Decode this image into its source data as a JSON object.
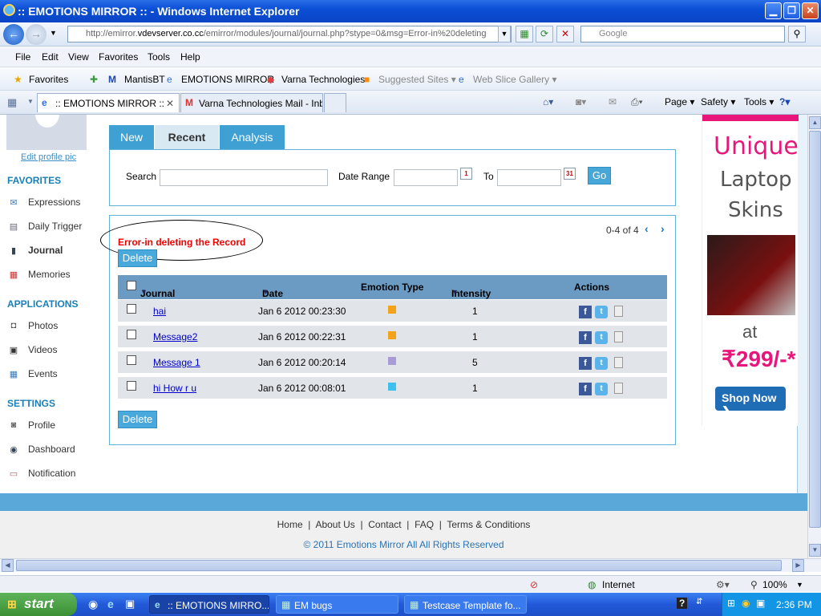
{
  "window": {
    "title": ":: EMOTIONS MIRROR :: - Windows Internet Explorer"
  },
  "addressbar": {
    "url_prefix": "http://emirror.",
    "url_host": "vdevserver.co.cc",
    "url_path": "/emirror/modules/journal/journal.php?stype=0&msg=Error-in%20deleting",
    "search_placeholder": "Google"
  },
  "menu": [
    "File",
    "Edit",
    "View",
    "Favorites",
    "Tools",
    "Help"
  ],
  "favorites_bar": {
    "favorites": "Favorites",
    "items": [
      "MantisBT",
      "EMOTIONS MIRROR",
      "Varna Technologies",
      "Suggested Sites ▾",
      "Web Slice Gallery ▾"
    ]
  },
  "tabs": [
    ":: EMOTIONS MIRROR ::",
    "Varna Technologies Mail - Inb..."
  ],
  "commandbar": {
    "page": "Page ▾",
    "safety": "Safety ▾",
    "tools": "Tools ▾"
  },
  "sidebar": {
    "edit_profile": "Edit profile pic",
    "favorites_heading": "FAVORITES",
    "favorites": [
      "Expressions",
      "Daily Trigger",
      "Journal",
      "Memories"
    ],
    "applications_heading": "APPLICATIONS",
    "applications": [
      "Photos",
      "Videos",
      "Events"
    ],
    "settings_heading": "SETTINGS",
    "settings": [
      "Profile",
      "Dashboard",
      "Notification"
    ]
  },
  "main_tabs": [
    "New",
    "Recent",
    "Analysis"
  ],
  "search": {
    "label": "Search",
    "date_range_label": "Date Range",
    "to_label": "To",
    "go": "Go",
    "cal_from": "1",
    "cal_to": "31"
  },
  "journal": {
    "error": "Error-in deleting the Record",
    "delete": "Delete",
    "pager": "0-4 of 4",
    "columns": [
      "Journal",
      "Date",
      "Emotion Type",
      "Intensity",
      "Actions"
    ],
    "rows": [
      {
        "title": "hai",
        "date": "Jan 6 2012 00:23:30",
        "color": "#f5a11a",
        "intensity": "1"
      },
      {
        "title": "Message2",
        "date": "Jan 6 2012 00:22:31",
        "color": "#f5a11a",
        "intensity": "1"
      },
      {
        "title": "Message 1",
        "date": "Jan 6 2012 00:20:14",
        "color": "#a99bd6",
        "intensity": "5"
      },
      {
        "title": "hi How r u",
        "date": "Jan 6 2012 00:08:01",
        "color": "#3cc0ee",
        "intensity": "1"
      }
    ]
  },
  "ad": {
    "line1": "Unique",
    "line2": "Laptop",
    "line3": "Skins",
    "at": "at",
    "price": "₹299/-*",
    "shop": "Shop Now"
  },
  "footer": {
    "links": [
      "Home",
      "About Us",
      "Contact",
      "FAQ",
      "Terms & Conditions"
    ],
    "copyright": "© 2011 Emotions Mirror All All Rights Reserved"
  },
  "status": {
    "zone": "Internet",
    "zoom": "100%"
  },
  "taskbar": {
    "start": "start",
    "tasks": [
      ":: EMOTIONS MIRRO...",
      "EM bugs",
      "Testcase Template fo..."
    ],
    "time": "2:36 PM"
  }
}
